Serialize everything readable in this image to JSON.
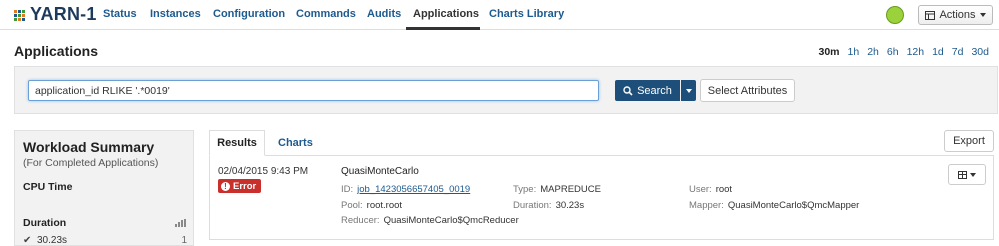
{
  "app": {
    "title": "YARN-1",
    "brand_colors": [
      "#e07b22",
      "#1d5a8e",
      "#3a9a3a"
    ]
  },
  "nav": {
    "tabs": [
      {
        "label": "Status"
      },
      {
        "label": "Instances"
      },
      {
        "label": "Configuration"
      },
      {
        "label": "Commands"
      },
      {
        "label": "Audits"
      },
      {
        "label": "Applications",
        "active": true
      },
      {
        "label": "Charts Library"
      }
    ],
    "status_color": "#9bd13b",
    "actions_label": "Actions"
  },
  "page": {
    "title": "Applications",
    "time_ranges": [
      "30m",
      "1h",
      "2h",
      "6h",
      "12h",
      "1d",
      "7d",
      "30d"
    ],
    "selected_time_range": "30m"
  },
  "search": {
    "query": "application_id RLIKE '.*0019'",
    "search_label": "Search",
    "select_attributes_label": "Select Attributes"
  },
  "workload": {
    "title": "Workload Summary",
    "subtitle": "(For Completed Applications)",
    "cpu_label": "CPU Time",
    "duration_label": "Duration",
    "duration_rows": [
      {
        "value": "30.23s",
        "count": "1"
      }
    ]
  },
  "results": {
    "tabs": [
      {
        "label": "Results",
        "active": true
      },
      {
        "label": "Charts"
      }
    ],
    "export_label": "Export",
    "items": [
      {
        "date": "02/04/2015 9:43 PM",
        "status": "Error",
        "name": "QuasiMonteCarlo",
        "id_label": "ID:",
        "id": "job_1423056657405_0019",
        "type_label": "Type:",
        "type": "MAPREDUCE",
        "user_label": "User:",
        "user": "root",
        "pool_label": "Pool:",
        "pool": "root.root",
        "duration_label": "Duration:",
        "duration": "30.23s",
        "mapper_label": "Mapper:",
        "mapper": "QuasiMonteCarlo$QmcMapper",
        "reducer_label": "Reducer:",
        "reducer": "QuasiMonteCarlo$QmcReducer"
      }
    ]
  },
  "icons": {
    "search": "search-icon",
    "table": "table-icon",
    "check": "check-icon",
    "bar_chart": "bar-chart-icon",
    "error": "exclamation-circle-icon"
  }
}
